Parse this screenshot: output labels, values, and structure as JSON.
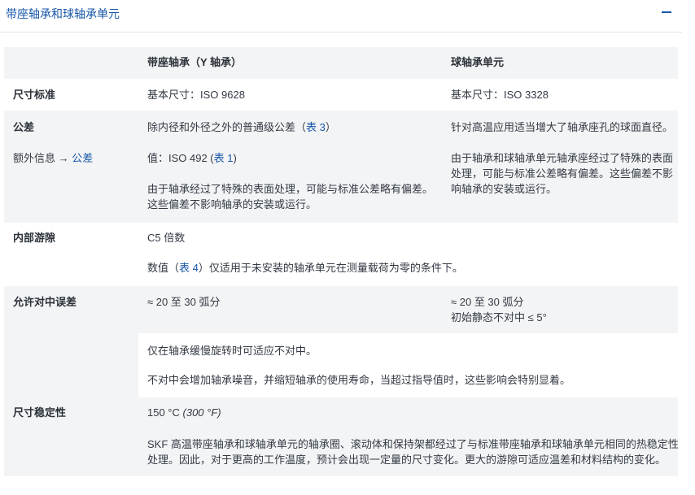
{
  "section": {
    "title": "带座轴承和球轴承单元",
    "collapse_icon": "minus-icon"
  },
  "table": {
    "headers": [
      "",
      "带座轴承（Y 轴承）",
      "球轴承单元"
    ],
    "dimension_std": {
      "label": "尺寸标准",
      "col1": "基本尺寸：ISO 9628",
      "col2": "基本尺寸：ISO 3328"
    },
    "tolerance": {
      "label": "公差",
      "extra_label": "额外信息 →",
      "extra_link": "公差",
      "col1_line1_pre": "除内径和外径之外的普通级公差（",
      "col1_line1_link": "表 3",
      "col1_line1_post": "）",
      "col1_line2_pre": "值：ISO 492 (",
      "col1_line2_link": "表 1",
      "col1_line2_post": ")",
      "col1_para_1": "由于轴承经过了特殊的表面处理，可能与标准公差略有偏差。",
      "col1_para_2": "这些偏差不影响轴承的安装或运行。",
      "col2_line1": "针对高温应用适当增大了轴承座孔的球面直径。",
      "col2_para_1": "由于轴承和球轴承单元轴承座经过了特殊的表面",
      "col2_para_2": "处理，可能与标准公差略有偏差。这些偏差不影",
      "col2_para_3": "响轴承的安装或运行。"
    },
    "clearance": {
      "label": "内部游隙",
      "value": "C5 倍数",
      "note_pre": "数值（",
      "note_link": "表 4",
      "note_post": "）仅适用于未安装的轴承单元在测量载荷为零的条件下。"
    },
    "misalignment": {
      "label": "允许对中误差",
      "col1": "≈ 20 至 30 弧分",
      "col2_line1": "≈ 20 至 30 弧分",
      "col2_line2": "初始静态不对中 ≤ 5°",
      "note1": "仅在轴承缓慢旋转时可适应不对中。",
      "note2": "不对中会增加轴承噪音，并缩短轴承的使用寿命，当超过指导值时，这些影响会特别显着。"
    },
    "stability": {
      "label": "尺寸稳定性",
      "temp": "150 °C",
      "temp_f": "(300 °F)",
      "note_1": "SKF 高温带座轴承和球轴承单元的轴承圈、滚动体和保持架都经过了与标准带座轴承和球轴承单元相同的热稳定性",
      "note_2": "处理。因此，对于更高的工作温度，预计会出现一定量的尺寸变化。更大的游隙可适应温差和材料结构的变化。"
    }
  }
}
